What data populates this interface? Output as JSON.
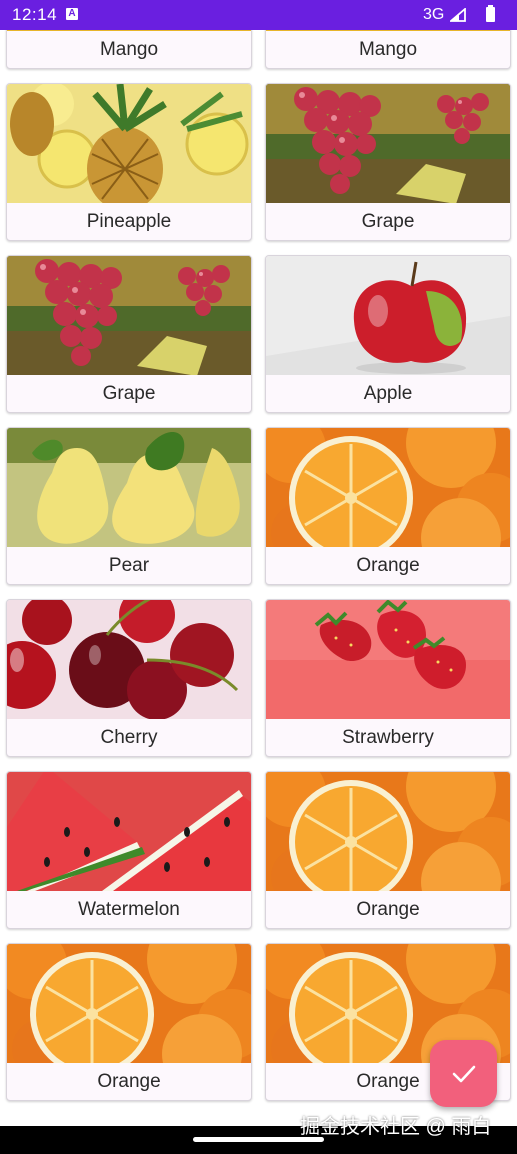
{
  "status_bar": {
    "time": "12:14",
    "notification_glyph": "A",
    "network": "3G"
  },
  "fruits": [
    {
      "label": "Mango",
      "image": "mango"
    },
    {
      "label": "Mango",
      "image": "mango"
    },
    {
      "label": "Pineapple",
      "image": "pineapple"
    },
    {
      "label": "Grape",
      "image": "grape"
    },
    {
      "label": "Grape",
      "image": "grape"
    },
    {
      "label": "Apple",
      "image": "apple"
    },
    {
      "label": "Pear",
      "image": "pear"
    },
    {
      "label": "Orange",
      "image": "orange"
    },
    {
      "label": "Cherry",
      "image": "cherry"
    },
    {
      "label": "Strawberry",
      "image": "strawberry"
    },
    {
      "label": "Watermelon",
      "image": "watermelon"
    },
    {
      "label": "Orange",
      "image": "orange"
    },
    {
      "label": "Orange",
      "image": "orange"
    },
    {
      "label": "Orange",
      "image": "orange"
    }
  ],
  "fab": {
    "icon": "check-icon",
    "color": "#f2607c"
  },
  "watermark": "掘金技术社区 @ 雨白",
  "colors": {
    "status_bar": "#6a1fe0",
    "card_background": "#fdf8fd"
  }
}
